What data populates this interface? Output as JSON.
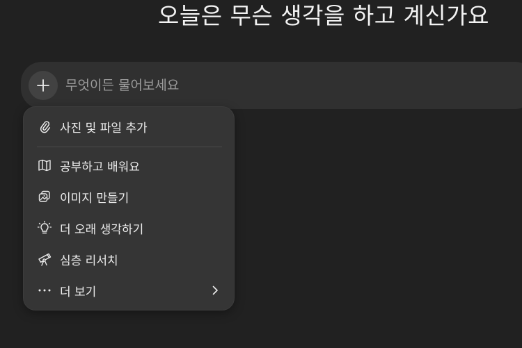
{
  "hero": {
    "title": "오늘은 무슨 생각을 하고 계신가요"
  },
  "composer": {
    "placeholder": "무엇이든 물어보세요",
    "value": "",
    "plus_icon": "plus-icon"
  },
  "menu": {
    "attach": {
      "label": "사진 및 파일 추가",
      "icon": "paperclip-icon"
    },
    "items": [
      {
        "label": "공부하고 배워요",
        "icon": "book-icon"
      },
      {
        "label": "이미지 만들기",
        "icon": "image-icon"
      },
      {
        "label": "더 오래 생각하기",
        "icon": "lightbulb-icon"
      },
      {
        "label": "심층 리서치",
        "icon": "telescope-icon"
      },
      {
        "label": "더 보기",
        "icon": "more-dots-icon",
        "submenu_icon": "chevron-right-icon"
      }
    ]
  },
  "colors": {
    "background": "#212121",
    "composer": "#303030",
    "menu": "#353535",
    "text": "#ececec",
    "placeholder": "#9b9b9b"
  }
}
